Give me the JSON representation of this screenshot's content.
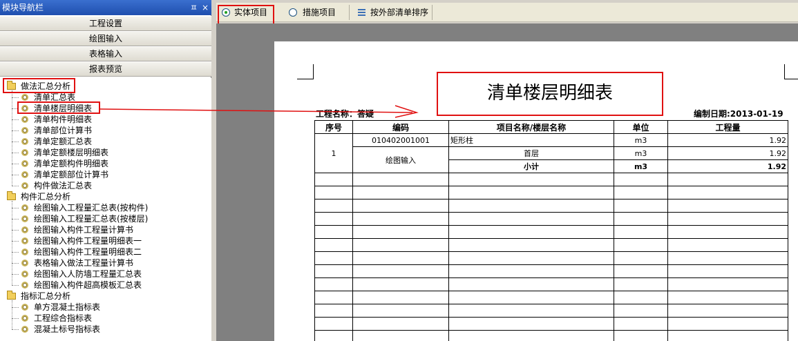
{
  "nav": {
    "title": "模块导航栏",
    "pin_glyph": "ㅍ",
    "close_glyph": "×",
    "buttons": [
      "工程设置",
      "绘图输入",
      "表格输入",
      "报表预览"
    ],
    "tree": [
      {
        "label": "做法汇总分析",
        "folder": true
      },
      {
        "label": "清单汇总表"
      },
      {
        "label": "清单楼层明细表"
      },
      {
        "label": "清单构件明细表"
      },
      {
        "label": "清单部位计算书"
      },
      {
        "label": "清单定额汇总表"
      },
      {
        "label": "清单定额楼层明细表"
      },
      {
        "label": "清单定额构件明细表"
      },
      {
        "label": "清单定额部位计算书"
      },
      {
        "label": "构件做法汇总表"
      },
      {
        "label": "构件汇总分析",
        "folder": true
      },
      {
        "label": "绘图输入工程量汇总表(按构件)"
      },
      {
        "label": "绘图输入工程量汇总表(按楼层)"
      },
      {
        "label": "绘图输入构件工程量计算书"
      },
      {
        "label": "绘图输入构件工程量明细表一"
      },
      {
        "label": "绘图输入构件工程量明细表二"
      },
      {
        "label": "表格输入做法工程量计算书"
      },
      {
        "label": "绘图输入人防墙工程量汇总表"
      },
      {
        "label": "绘图输入构件超高模板汇总表"
      },
      {
        "label": "指标汇总分析",
        "folder": true
      },
      {
        "label": "单方混凝土指标表"
      },
      {
        "label": "工程综合指标表"
      },
      {
        "label": "混凝土标号指标表"
      }
    ]
  },
  "toolbar": {
    "radio_entity": "实体项目",
    "radio_measure": "措施项目",
    "sort_label": "按外部清单排序"
  },
  "report": {
    "title": "清单楼层明细表",
    "project_label": "工程名称：答疑",
    "date_label": "编制日期:2013-01-19",
    "headers": [
      "序号",
      "编码",
      "项目名称/楼层名称",
      "单位",
      "工程量"
    ],
    "row_index": "1",
    "code": "010402001001",
    "item_name": "矩形柱",
    "unit": "m3",
    "qty": "1.92",
    "source": "绘图输入",
    "floor_name": "首层",
    "floor_unit": "m3",
    "floor_qty": "1.92",
    "subtotal_label": "小计",
    "subtotal_unit": "m3",
    "subtotal_qty": "1.92"
  },
  "colors": {
    "highlight": "#e01010",
    "titlebar": "#2a5cbf",
    "canvas": "#808080"
  }
}
